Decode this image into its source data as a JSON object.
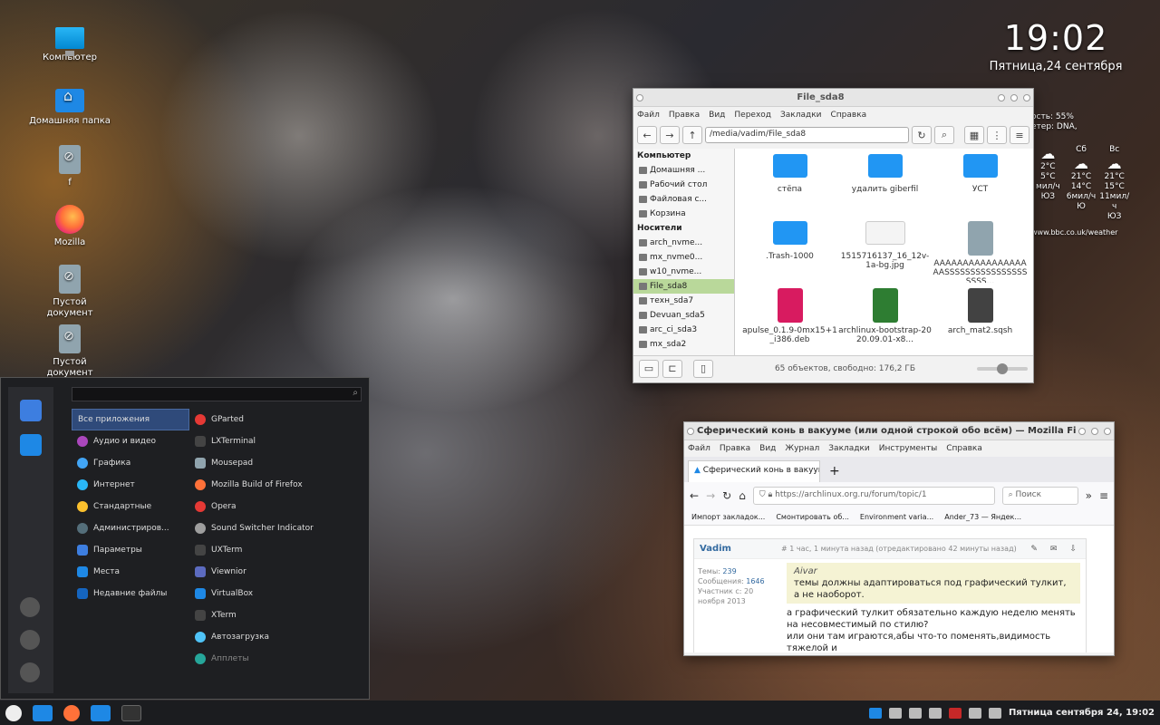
{
  "desktop": {
    "icons": [
      {
        "label": "Компьютер"
      },
      {
        "label": "Домашняя папка"
      },
      {
        "label": "f"
      },
      {
        "label": "Mozilla"
      },
      {
        "label": "Пустой документ"
      },
      {
        "label": "Пустой документ"
      }
    ]
  },
  "clock": {
    "time": "19:02",
    "date": "Пятница,24 сентября"
  },
  "weather": {
    "line1": "ость: 55%",
    "line2": "етер: DNA,",
    "days": [
      {
        "day": "",
        "hi": "2°C",
        "lo": "5°C",
        "wind": "мил/ч",
        "dir": "ЮЗ"
      },
      {
        "day": "Сб",
        "hi": "21°C",
        "lo": "14°C",
        "wind": "6мил/ч",
        "dir": "Ю"
      },
      {
        "day": "Вс",
        "hi": "21°C",
        "lo": "15°C",
        "wind": "11мил/ч",
        "dir": "ЮЗ"
      }
    ],
    "link": "www.bbc.co.uk/weather"
  },
  "file_manager": {
    "title": "File_sda8",
    "menu": [
      "Файл",
      "Правка",
      "Вид",
      "Переход",
      "Закладки",
      "Справка"
    ],
    "path": "/media/vadim/File_sda8",
    "sidebar": {
      "computer_header": "Компьютер",
      "computer_items": [
        "Домашняя ...",
        "Рабочий стол",
        "Файловая с...",
        "Корзина"
      ],
      "devices_header": "Носители",
      "device_items": [
        "arch_nvme...",
        "mx_nvme0...",
        "w10_nvme...",
        "File_sda8",
        "техн_sda7",
        "Devuan_sda5",
        "arc_ci_sda3",
        "mx_sda2"
      ]
    },
    "files": [
      {
        "name": "стёпа",
        "kind": "folder"
      },
      {
        "name": "удалить giberfil",
        "kind": "folder"
      },
      {
        "name": "УСТ",
        "kind": "folder"
      },
      {
        "name": ".Trash-1000",
        "kind": "folder"
      },
      {
        "name": "1515716137_16_12v-1a-bg.jpg",
        "kind": "image"
      },
      {
        "name": "AAAAAAAAAAAAAAAAAASSSSSSSSSSSSSSSSSSSS...",
        "kind": "file"
      },
      {
        "name": "apulse_0.1.9-0mx15+1_i386.deb",
        "kind": "deb"
      },
      {
        "name": "archlinux-bootstrap-2020.09.01-x8...",
        "kind": "tar"
      },
      {
        "name": "arch_mat2.sqsh",
        "kind": "cd"
      }
    ],
    "status": "65 объектов, свободно: 176,2 ГБ"
  },
  "firefox": {
    "title": "Сферический конь в вакууме (или одной строкой обо всём) — Mozilla Fire...",
    "menu": [
      "Файл",
      "Правка",
      "Вид",
      "Журнал",
      "Закладки",
      "Инструменты",
      "Справка"
    ],
    "tab": "Сферический конь в вакуум",
    "url": "https://archlinux.org.ru/forum/topic/1",
    "search_placeholder": "Поиск",
    "bookmarks": [
      "Импорт закладок...",
      "Смонтировать об...",
      "Environment varia...",
      "Ander_73 — Яндек..."
    ],
    "post": {
      "author": "Vadim",
      "meta": "# 1 час, 1 минута назад (отредактировано 42 минуты назад)",
      "topics_label": "Темы:",
      "topics": "239",
      "messages_label": "Сообщения:",
      "messages": "1646",
      "member": "Участник с: 20 ноября 2013",
      "quote_author": "Aivar",
      "quote": "темы должны адаптироваться под графический тулкит, а не наоборот.",
      "reply": "а графический тулкит обязательно каждую неделю менять на несовместимый по стилю?",
      "reply2": "или они там играются,абы что-то поменять,видимость тяжелой и"
    }
  },
  "app_menu": {
    "search_placeholder": "",
    "categories": [
      "Все приложения",
      "Аудио и видео",
      "Графика",
      "Интернет",
      "Стандартные",
      "Администриров...",
      "Параметры",
      "Места",
      "Недавние файлы"
    ],
    "apps": [
      "GParted",
      "LXTerminal",
      "Mousepad",
      "Mozilla Build of Firefox",
      "Opera",
      "Sound Switcher Indicator",
      "UXTerm",
      "Viewnior",
      "VirtualBox",
      "XTerm",
      "Автозагрузка",
      "Апплеты"
    ]
  },
  "taskbar": {
    "clock": "Пятница сентября 24, 19:02"
  },
  "colors": {
    "accent": "#2196f3",
    "menu_selected": "#2f4a7a",
    "sidebar_selected": "#b9d89a"
  }
}
